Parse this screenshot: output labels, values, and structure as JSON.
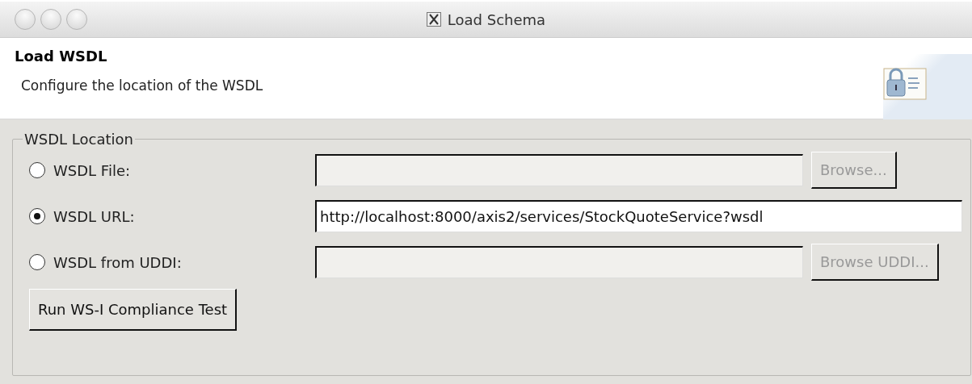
{
  "window": {
    "title": "Load Schema"
  },
  "header": {
    "title": "Load WSDL",
    "description": "Configure the location of the WSDL"
  },
  "group": {
    "title": "WSDL Location",
    "options": [
      {
        "label": "WSDL File:",
        "selected": false,
        "disabled": true,
        "button": {
          "label": "Browse...",
          "disabled": true
        }
      },
      {
        "label": "WSDL URL:",
        "selected": true,
        "value": "http://localhost:8000/axis2/services/StockQuoteService?wsdl",
        "disabled": false
      },
      {
        "label": "WSDL from UDDI:",
        "selected": false,
        "disabled": true,
        "button": {
          "label": "Browse UDDI...",
          "disabled": true
        }
      }
    ],
    "action": "Run WS-I Compliance Test"
  }
}
